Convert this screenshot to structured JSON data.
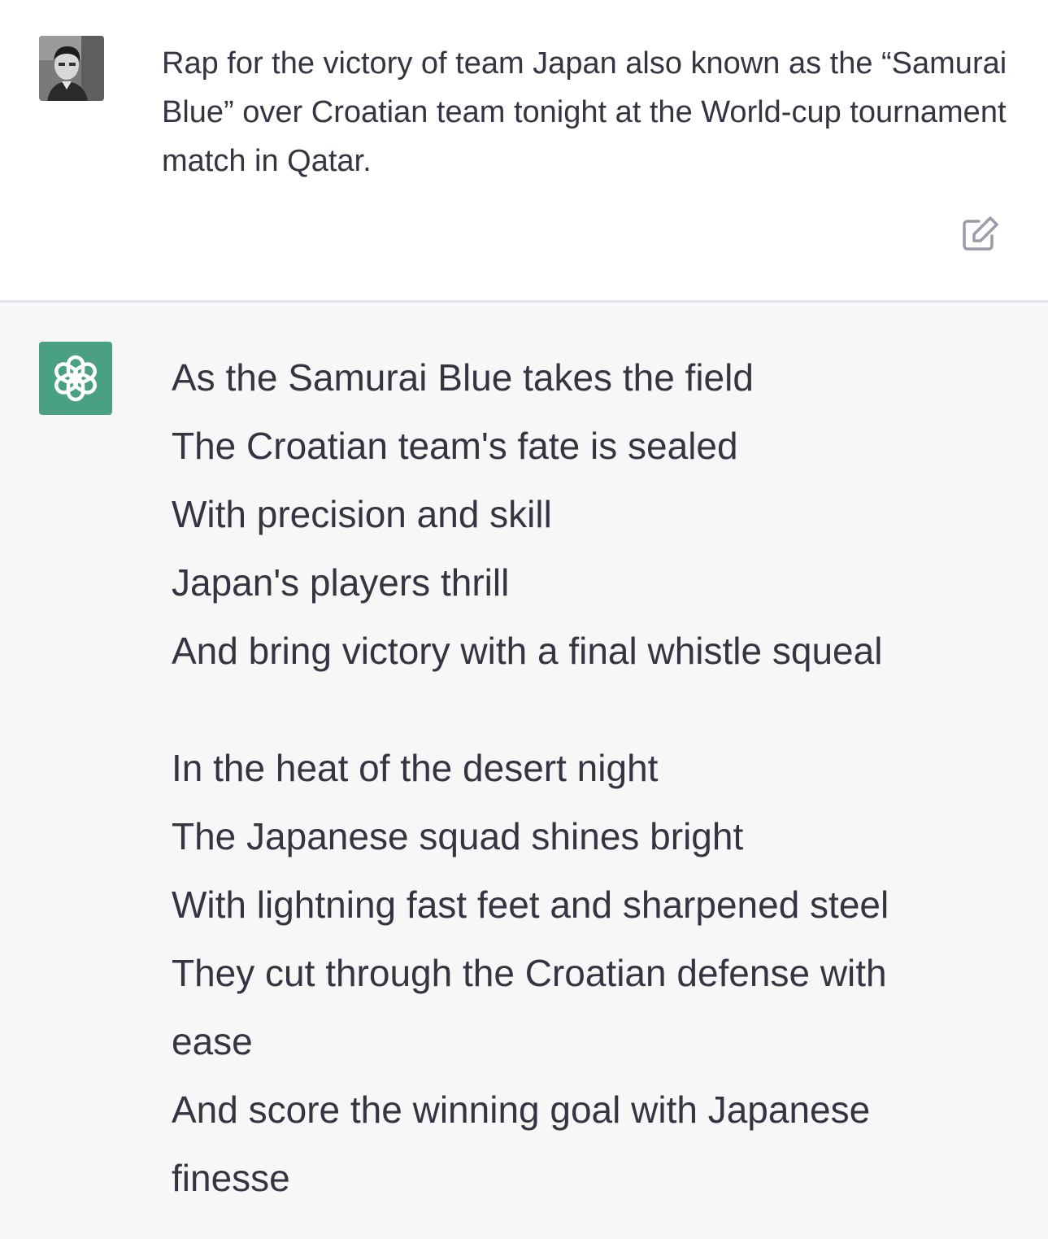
{
  "user": {
    "avatar_icon": "user-avatar-photo",
    "message": "Rap for the victory of team Japan also known as the “Samurai Blue” over Croatian team tonight at the World-cup tournament match in Qatar.",
    "edit_icon": "edit-icon"
  },
  "assistant": {
    "avatar_icon": "openai-logo-icon",
    "avatar_color": "#4aa181",
    "background_color": "#f7f7f8",
    "verses": [
      {
        "lines": [
          "As the Samurai Blue takes the field",
          "The Croatian team's fate is sealed",
          "With precision and skill",
          "Japan's players thrill",
          "And bring victory with a final whistle squeal"
        ]
      },
      {
        "lines": [
          "In the heat of the desert night",
          "The Japanese squad shines bright",
          "With lightning fast feet and sharpened steel",
          "They cut through the Croatian defense with",
          "ease",
          "And score the winning goal with Japanese",
          "finesse"
        ]
      }
    ]
  }
}
